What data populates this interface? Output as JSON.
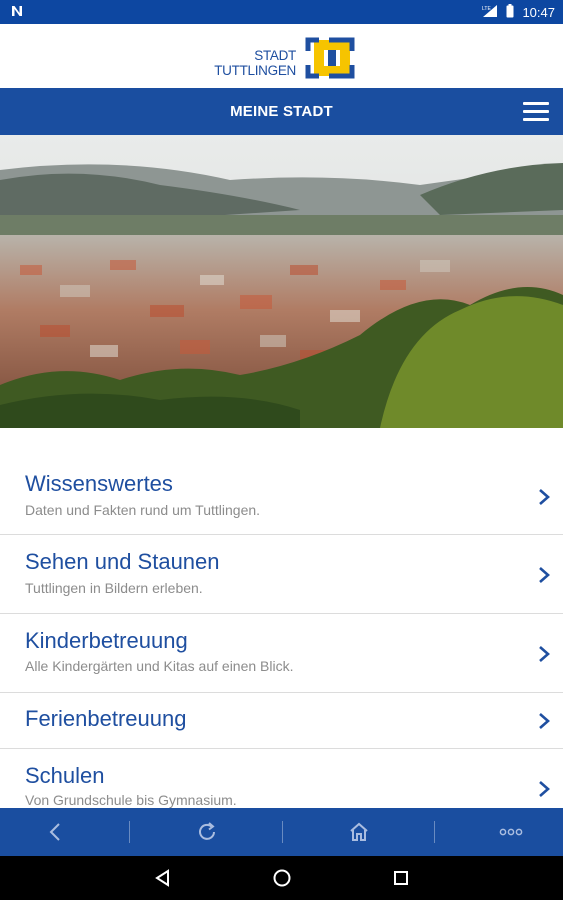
{
  "status_bar": {
    "notification_icon": "n-icon",
    "time": "10:47"
  },
  "logo": {
    "line1": "STADT",
    "line2": "TUTTLINGEN",
    "brand_blue": "#1f4fa0",
    "brand_yellow": "#f6c400"
  },
  "nav": {
    "title": "MEINE STADT",
    "menu_icon": "hamburger-icon",
    "color": "#1a4ea0"
  },
  "hero": {
    "description_icon": "city-panorama-image"
  },
  "menu": {
    "items": [
      {
        "title": "Wissenswertes",
        "subtitle": "Daten und Fakten rund um Tuttlingen."
      },
      {
        "title": "Sehen und Staunen",
        "subtitle": "Tuttlingen in Bildern erleben."
      },
      {
        "title": "Kinderbetreuung",
        "subtitle": "Alle Kindergärten und Kitas auf einen Blick."
      },
      {
        "title": "Ferienbetreuung",
        "subtitle": ""
      },
      {
        "title": "Schulen",
        "subtitle": "Von Grundschule bis Gymnasium."
      }
    ]
  },
  "toolbar": {
    "icons": [
      "back-icon",
      "refresh-icon",
      "home-icon",
      "more-icon"
    ]
  },
  "android_nav": {
    "icons": [
      "back-triangle-icon",
      "home-circle-icon",
      "recents-square-icon"
    ]
  }
}
